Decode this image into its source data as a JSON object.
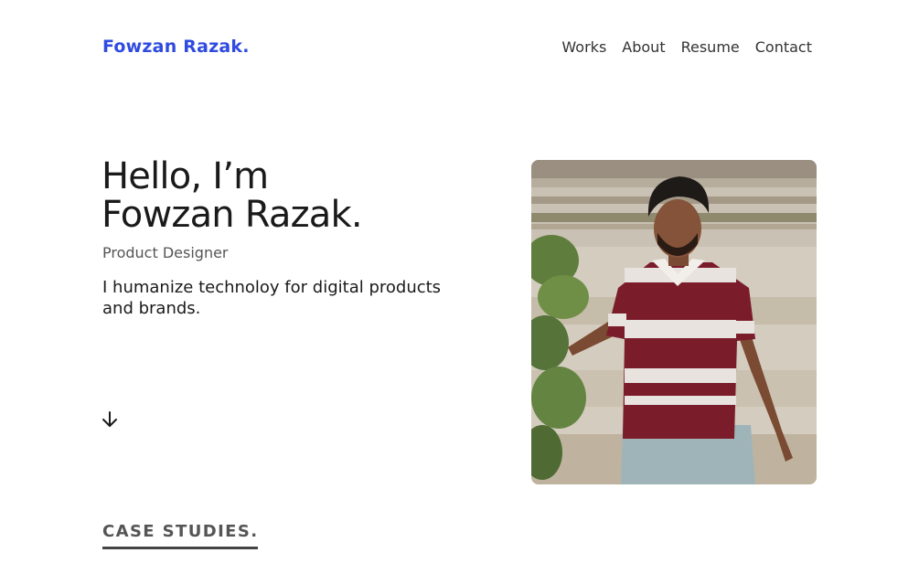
{
  "header": {
    "logo": "Fowzan Razak.",
    "nav": [
      {
        "label": "Works"
      },
      {
        "label": "About"
      },
      {
        "label": "Resume"
      },
      {
        "label": "Contact"
      }
    ]
  },
  "hero": {
    "greeting": "Hello, I’m",
    "name": "Fowzan Razak.",
    "role": "Product Designer",
    "tagline": "I humanize technoloy for digital products and brands.",
    "scroll_icon": "arrow-down-icon"
  },
  "sections": {
    "case_studies_heading": "CASE STUDIES."
  },
  "colors": {
    "accent": "#2f4be0",
    "text": "#1a1a1a",
    "muted": "#555555"
  }
}
